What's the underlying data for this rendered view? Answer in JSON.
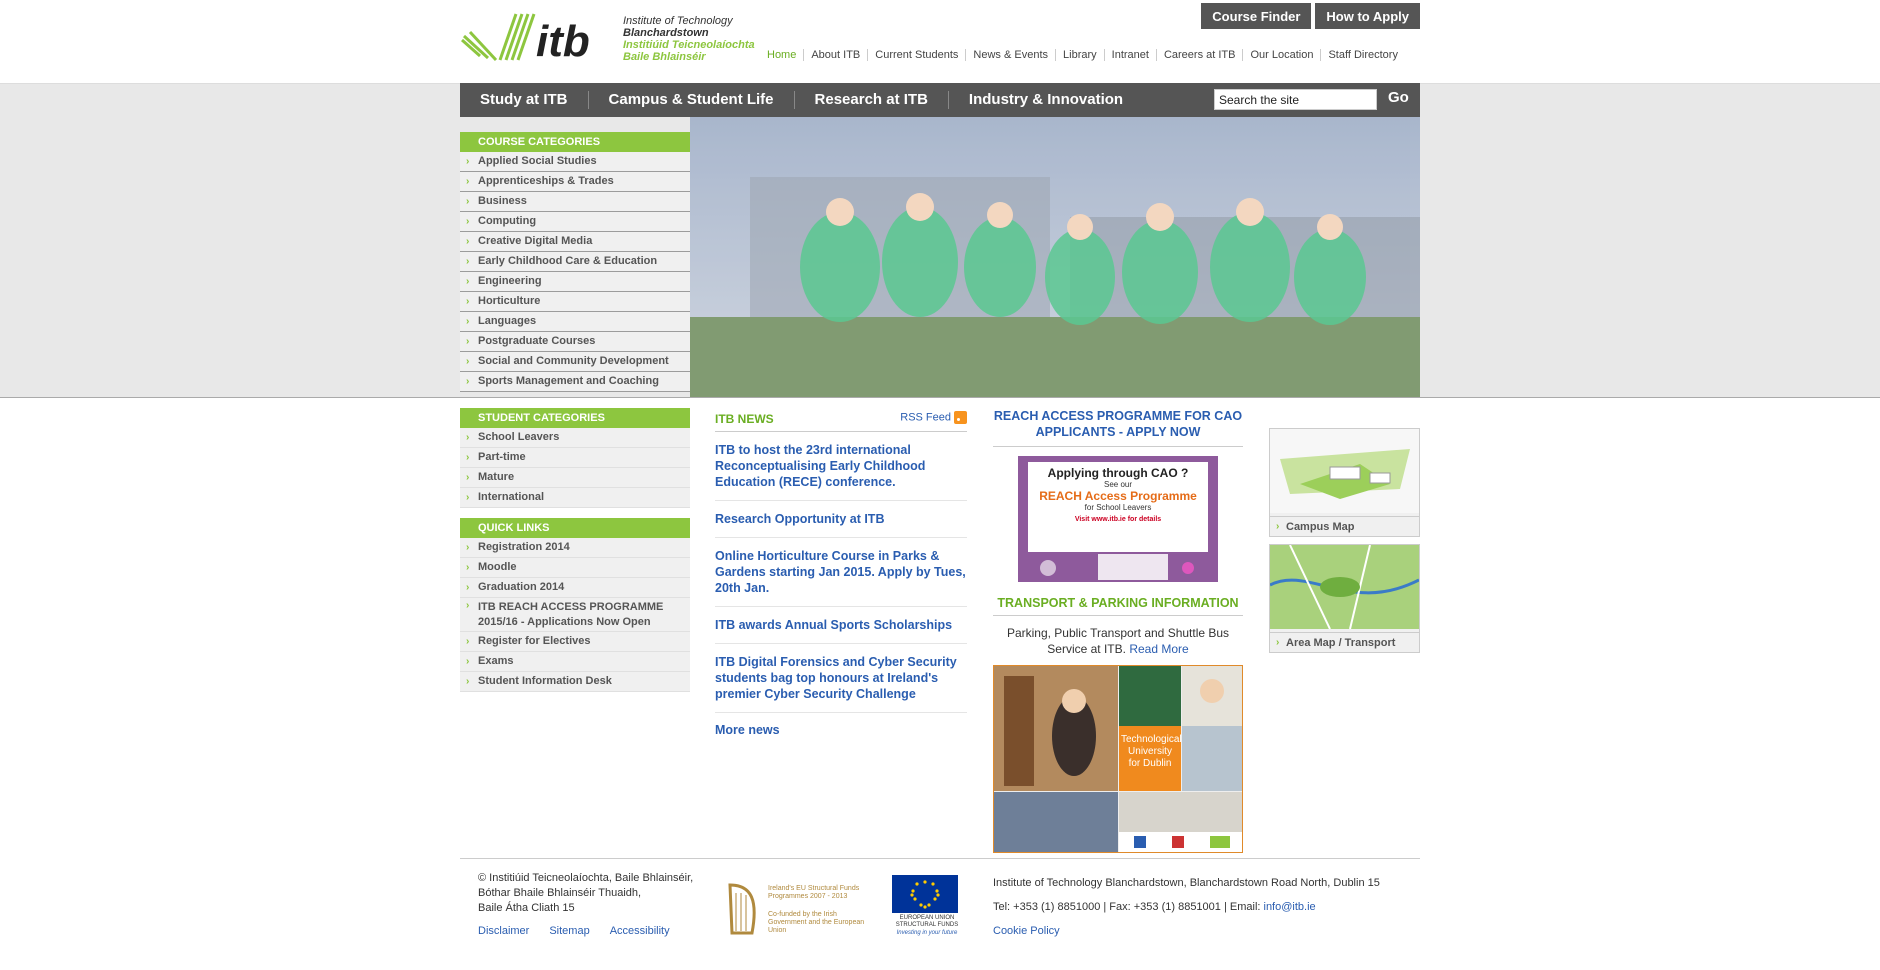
{
  "header": {
    "logo_text": "itb",
    "logo_lines": [
      "Institute of Technology",
      "Blanchardstown",
      "Institiúid Teicneolaíochta",
      "Baile Bhlainséir"
    ],
    "top_buttons": [
      "Course Finder",
      "How to Apply"
    ],
    "top_nav": [
      "Home",
      "About ITB",
      "Current Students",
      "News & Events",
      "Library",
      "Intranet",
      "Careers at ITB",
      "Our Location",
      "Staff Directory"
    ]
  },
  "main_nav": {
    "items": [
      "Study at ITB",
      "Campus & Student Life",
      "Research at ITB",
      "Industry & Innovation"
    ],
    "search_value": "Search the site",
    "go_label": "Go"
  },
  "course_categories": {
    "heading": "COURSE CATEGORIES",
    "items": [
      "Applied Social Studies",
      "Apprenticeships & Trades",
      "Business",
      "Computing",
      "Creative Digital Media",
      "Early Childhood Care & Education",
      "Engineering",
      "Horticulture",
      "Languages",
      "Postgraduate Courses",
      "Social and Community Development",
      "Sports Management and Coaching"
    ]
  },
  "student_categories": {
    "heading": "STUDENT CATEGORIES",
    "items": [
      "School Leavers",
      "Part-time",
      "Mature",
      "International"
    ]
  },
  "quick_links": {
    "heading": "QUICK LINKS",
    "items": [
      "Registration 2014",
      "Moodle",
      "Graduation 2014",
      "ITB REACH ACCESS PROGRAMME 2015/16 - Applications Now Open",
      "Register for Electives",
      "Exams",
      "Student Information Desk"
    ]
  },
  "news": {
    "heading": "ITB NEWS",
    "rss_label": "RSS Feed",
    "items": [
      "ITB to host the 23rd international Reconceptualising Early Childhood Education (RECE) conference.",
      "Research Opportunity at ITB",
      "Online Horticulture Course in Parks & Gardens starting Jan 2015. Apply by Tues, 20th Jan.",
      "ITB awards Annual Sports Scholarships",
      "ITB Digital Forensics and Cyber Security students bag top honours at Ireland's premier Cyber Security Challenge"
    ],
    "more_label": "More news"
  },
  "reach": {
    "title": "REACH ACCESS PROGRAMME FOR CAO APPLICANTS - APPLY NOW",
    "img_line1": "Applying through CAO ?",
    "img_line2": "See our",
    "img_line3": "REACH Access Programme",
    "img_line4": "for School Leavers",
    "img_line5": "Visit www.itb.ie for details"
  },
  "transport": {
    "title": "TRANSPORT & PARKING INFORMATION",
    "text": "Parking, Public Transport and Shuttle Bus Service at ITB.",
    "read_more": "Read More",
    "tu_label": "Technological University for Dublin"
  },
  "maps": {
    "campus_label": "Campus Map",
    "area_label": "Area Map / Transport"
  },
  "footer": {
    "address_lines": [
      "© Institiúid Teicneolaíochta, Baile Bhlainséir,",
      "Bóthar Bhaile Bhlainséir Thuaidh,",
      "Baile Átha Cliath 15"
    ],
    "links": [
      "Disclaimer",
      "Sitemap",
      "Accessibility"
    ],
    "eu_text1": "Ireland's EU Structural Funds Programmes 2007 - 2013",
    "eu_text2": "Co-funded by the Irish Government and the European Union",
    "eu_text3": "EUROPEAN UNION STRUCTURAL FUNDS",
    "eu_text4": "Investing in your future",
    "contact_line1": "Institute of Technology Blanchardstown, Blanchardstown Road North, Dublin 15",
    "contact_line2_prefix": "Tel: +353 (1) 8851000 | Fax: +353 (1) 8851001 | Email:",
    "email": "info@itb.ie",
    "cookie_label": "Cookie Policy"
  },
  "colors": {
    "brand_green": "#8dc63f",
    "nav_grey": "#555555",
    "link_blue": "#2a5db0"
  }
}
